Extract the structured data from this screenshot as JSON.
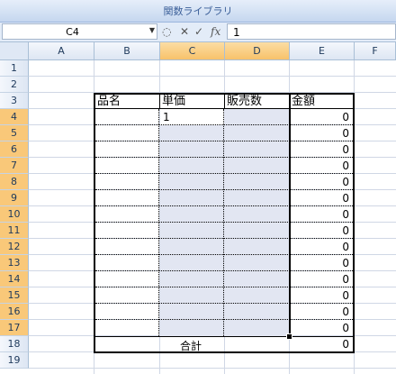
{
  "ribbon": {
    "group_label": "関数ライブラリ"
  },
  "formula_bar": {
    "name_box": "C4",
    "function_label": "fx",
    "cancel_label": "✕",
    "enter_label": "✓",
    "value": "1"
  },
  "sheet": {
    "columns": [
      "A",
      "B",
      "C",
      "D",
      "E",
      "F"
    ],
    "selected_columns": [
      "C",
      "D"
    ],
    "rows": [
      "1",
      "2",
      "3",
      "4",
      "5",
      "6",
      "7",
      "8",
      "9",
      "10",
      "11",
      "12",
      "13",
      "14",
      "15",
      "16",
      "17",
      "18",
      "19"
    ],
    "selected_rows": [
      "4",
      "5",
      "6",
      "7",
      "8",
      "9",
      "10",
      "11",
      "12",
      "13",
      "14",
      "15",
      "16",
      "17"
    ],
    "active_cell": "C4",
    "selection": "C4:D17",
    "table": {
      "headers": {
        "B": "品名",
        "C": "単価",
        "D": "販売数",
        "E": "金額"
      },
      "C4": "1",
      "amounts": [
        "0",
        "0",
        "0",
        "0",
        "0",
        "0",
        "0",
        "0",
        "0",
        "0",
        "0",
        "0",
        "0",
        "0"
      ],
      "total_label": "合計",
      "total_value": "0"
    }
  },
  "colors": {
    "selection_fill": "#e2e6f2",
    "header_selected": "#f8c26a",
    "ribbon_text": "#3b5f99"
  }
}
